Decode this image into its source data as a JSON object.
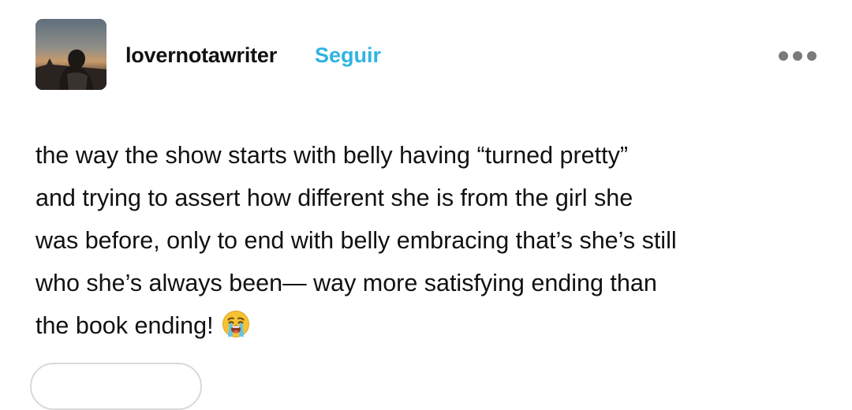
{
  "post": {
    "author": {
      "username": "lovernotawriter",
      "follow_label": "Seguir",
      "avatar_icon": "avatar-photo"
    },
    "more_icon": "more-options-icon",
    "text": "the way the show starts with belly having “turned pretty”\nand trying to assert how different she is from the girl she\nwas before, only to end with belly embracing that’s she’s still\nwho she’s always been— way more satisfying ending than\nthe book ending!",
    "emoji": "loudly-crying-face"
  },
  "colors": {
    "follow": "#2fb4e2",
    "text": "#111111",
    "more_dots": "#7a7a7a"
  }
}
